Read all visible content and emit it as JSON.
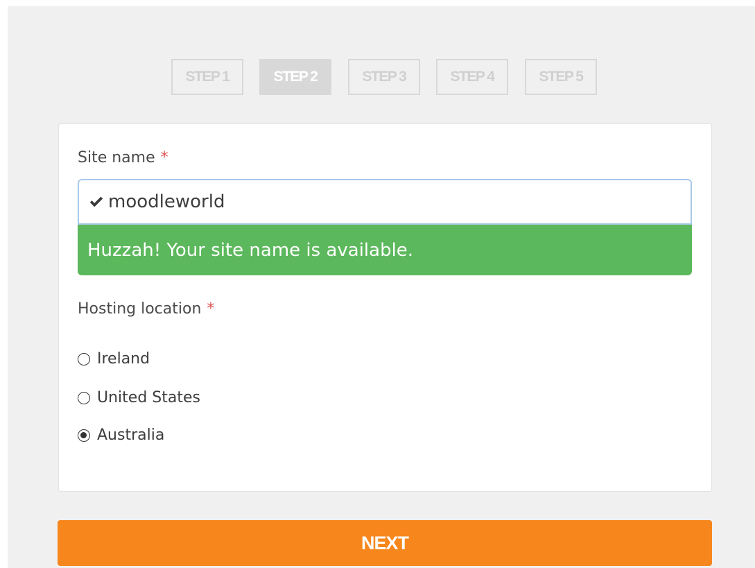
{
  "steps": [
    {
      "label": "STEP 1",
      "active": false
    },
    {
      "label": "STEP 2",
      "active": true
    },
    {
      "label": "STEP 3",
      "active": false
    },
    {
      "label": "STEP 4",
      "active": false
    },
    {
      "label": "STEP 5",
      "active": false
    }
  ],
  "form": {
    "site_name_label": "Site name",
    "required_marker": "*",
    "site_name_value": "moodleworld",
    "site_name_status_icon": "check-icon",
    "availability_message": "Huzzah! Your site name is available.",
    "hosting_label": "Hosting location",
    "hosting_options": [
      {
        "label": "Ireland",
        "checked": false
      },
      {
        "label": "United States",
        "checked": false
      },
      {
        "label": "Australia",
        "checked": true
      }
    ]
  },
  "actions": {
    "next_label": "NEXT"
  },
  "colors": {
    "success": "#5cb85c",
    "accent": "#f7871d",
    "required": "#d9534f",
    "step_inactive": "#d8d8d8"
  }
}
